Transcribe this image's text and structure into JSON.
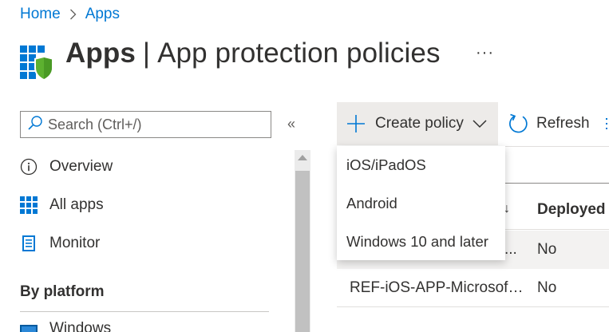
{
  "breadcrumb": {
    "home": "Home",
    "separator_icon": "chevron-right-icon",
    "current": "Apps"
  },
  "header": {
    "logo_icon": "apps-shield-icon",
    "title_strong": "Apps",
    "title_separator": "|",
    "title_sub": "App protection policies",
    "more_label": "···"
  },
  "sidebar": {
    "search_placeholder": "Search (Ctrl+/)",
    "collapse_label": "«",
    "items": [
      {
        "label": "Overview",
        "icon": "info-icon"
      },
      {
        "label": "All apps",
        "icon": "grid-icon"
      },
      {
        "label": "Monitor",
        "icon": "monitor-icon"
      }
    ],
    "section_label": "By platform",
    "windows_label": "Windows"
  },
  "toolbar": {
    "create_label": "Create policy",
    "refresh_label": "Refresh"
  },
  "create_menu": {
    "items": [
      "iOS/iPadOS",
      "Android",
      "Windows 10 and later"
    ]
  },
  "table": {
    "sort_indicator": "↓",
    "deployed_header": "Deployed",
    "rows": [
      {
        "name": "...",
        "deployed": "No"
      },
      {
        "name": "REF-iOS-APP-Microsoft ...",
        "deployed": "No"
      }
    ]
  },
  "colors": {
    "link": "#0078d4",
    "logo_blue": "#0078d4",
    "logo_green": "#5db130",
    "toolbar_active_bg": "#edebe9"
  }
}
